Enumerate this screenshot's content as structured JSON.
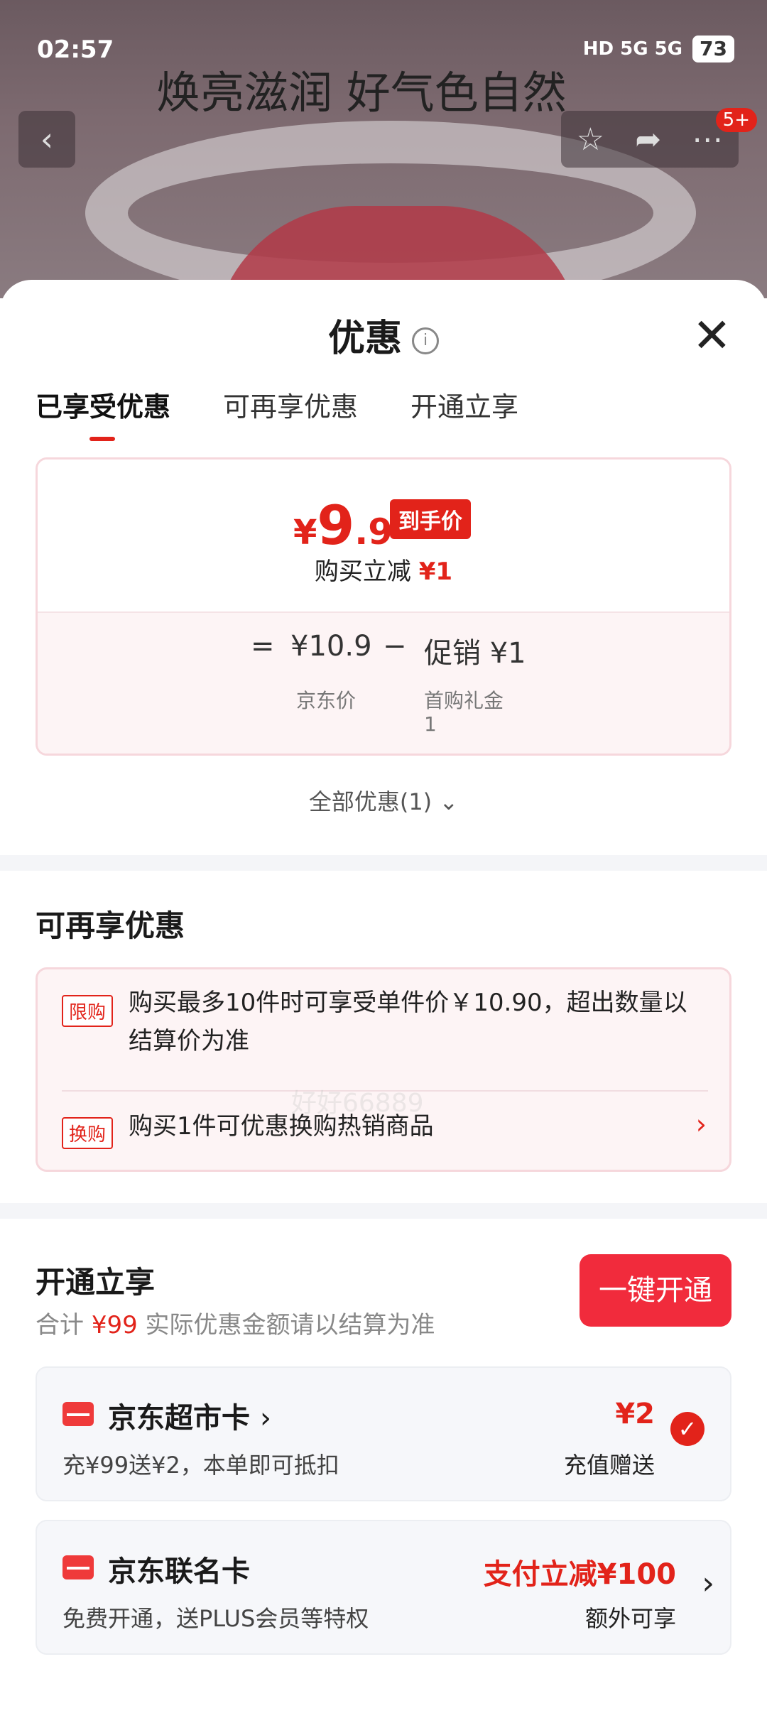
{
  "status_bar": {
    "time": "02:57",
    "network": "HD 5G 5G",
    "battery": "73"
  },
  "banner": {
    "text": "焕亮滋润 好气色自然",
    "badge": "5+"
  },
  "sheet": {
    "title": "优惠",
    "tabs": [
      "已享受优惠",
      "可再享优惠",
      "开通立享"
    ],
    "summary": {
      "currency": "¥",
      "price_int": "9",
      "price_dec": ".9",
      "tag": "到手价",
      "buy_less_label": "购买立减",
      "buy_less_value": "¥1",
      "eq": "=",
      "jd_price": "¥10.9",
      "jd_price_label": "京东价",
      "minus": "−",
      "promo": "促销 ¥1",
      "promo_sub_1": "首购礼金",
      "promo_sub_2": "1"
    },
    "all_offers": "全部优惠(1)",
    "watermark": "好好66889",
    "more_section": {
      "title": "可再享优惠",
      "items": [
        {
          "badge": "限购",
          "text_1": "购买最多10件时可享受单件价￥10.90，超出数量以",
          "text_2": "结算价为准"
        },
        {
          "badge": "换购",
          "text": "购买1件可优惠换购热销商品"
        }
      ]
    },
    "open_section": {
      "title": "开通立享",
      "total_label": "合计",
      "total_value": "¥99",
      "total_note": "实际优惠金额请以结算为准",
      "button": "一键开通",
      "cards": [
        {
          "title": "京东超市卡",
          "sub": "充¥99送¥2，本单即可抵扣",
          "value": "¥2",
          "value_label": "充值赠送",
          "checked": true
        },
        {
          "title": "京东联名卡",
          "sub": "免费开通，送PLUS会员等特权",
          "value": "支付立减¥100",
          "value_label": "额外可享"
        }
      ]
    }
  },
  "colors": {
    "accent": "#e2231a"
  }
}
